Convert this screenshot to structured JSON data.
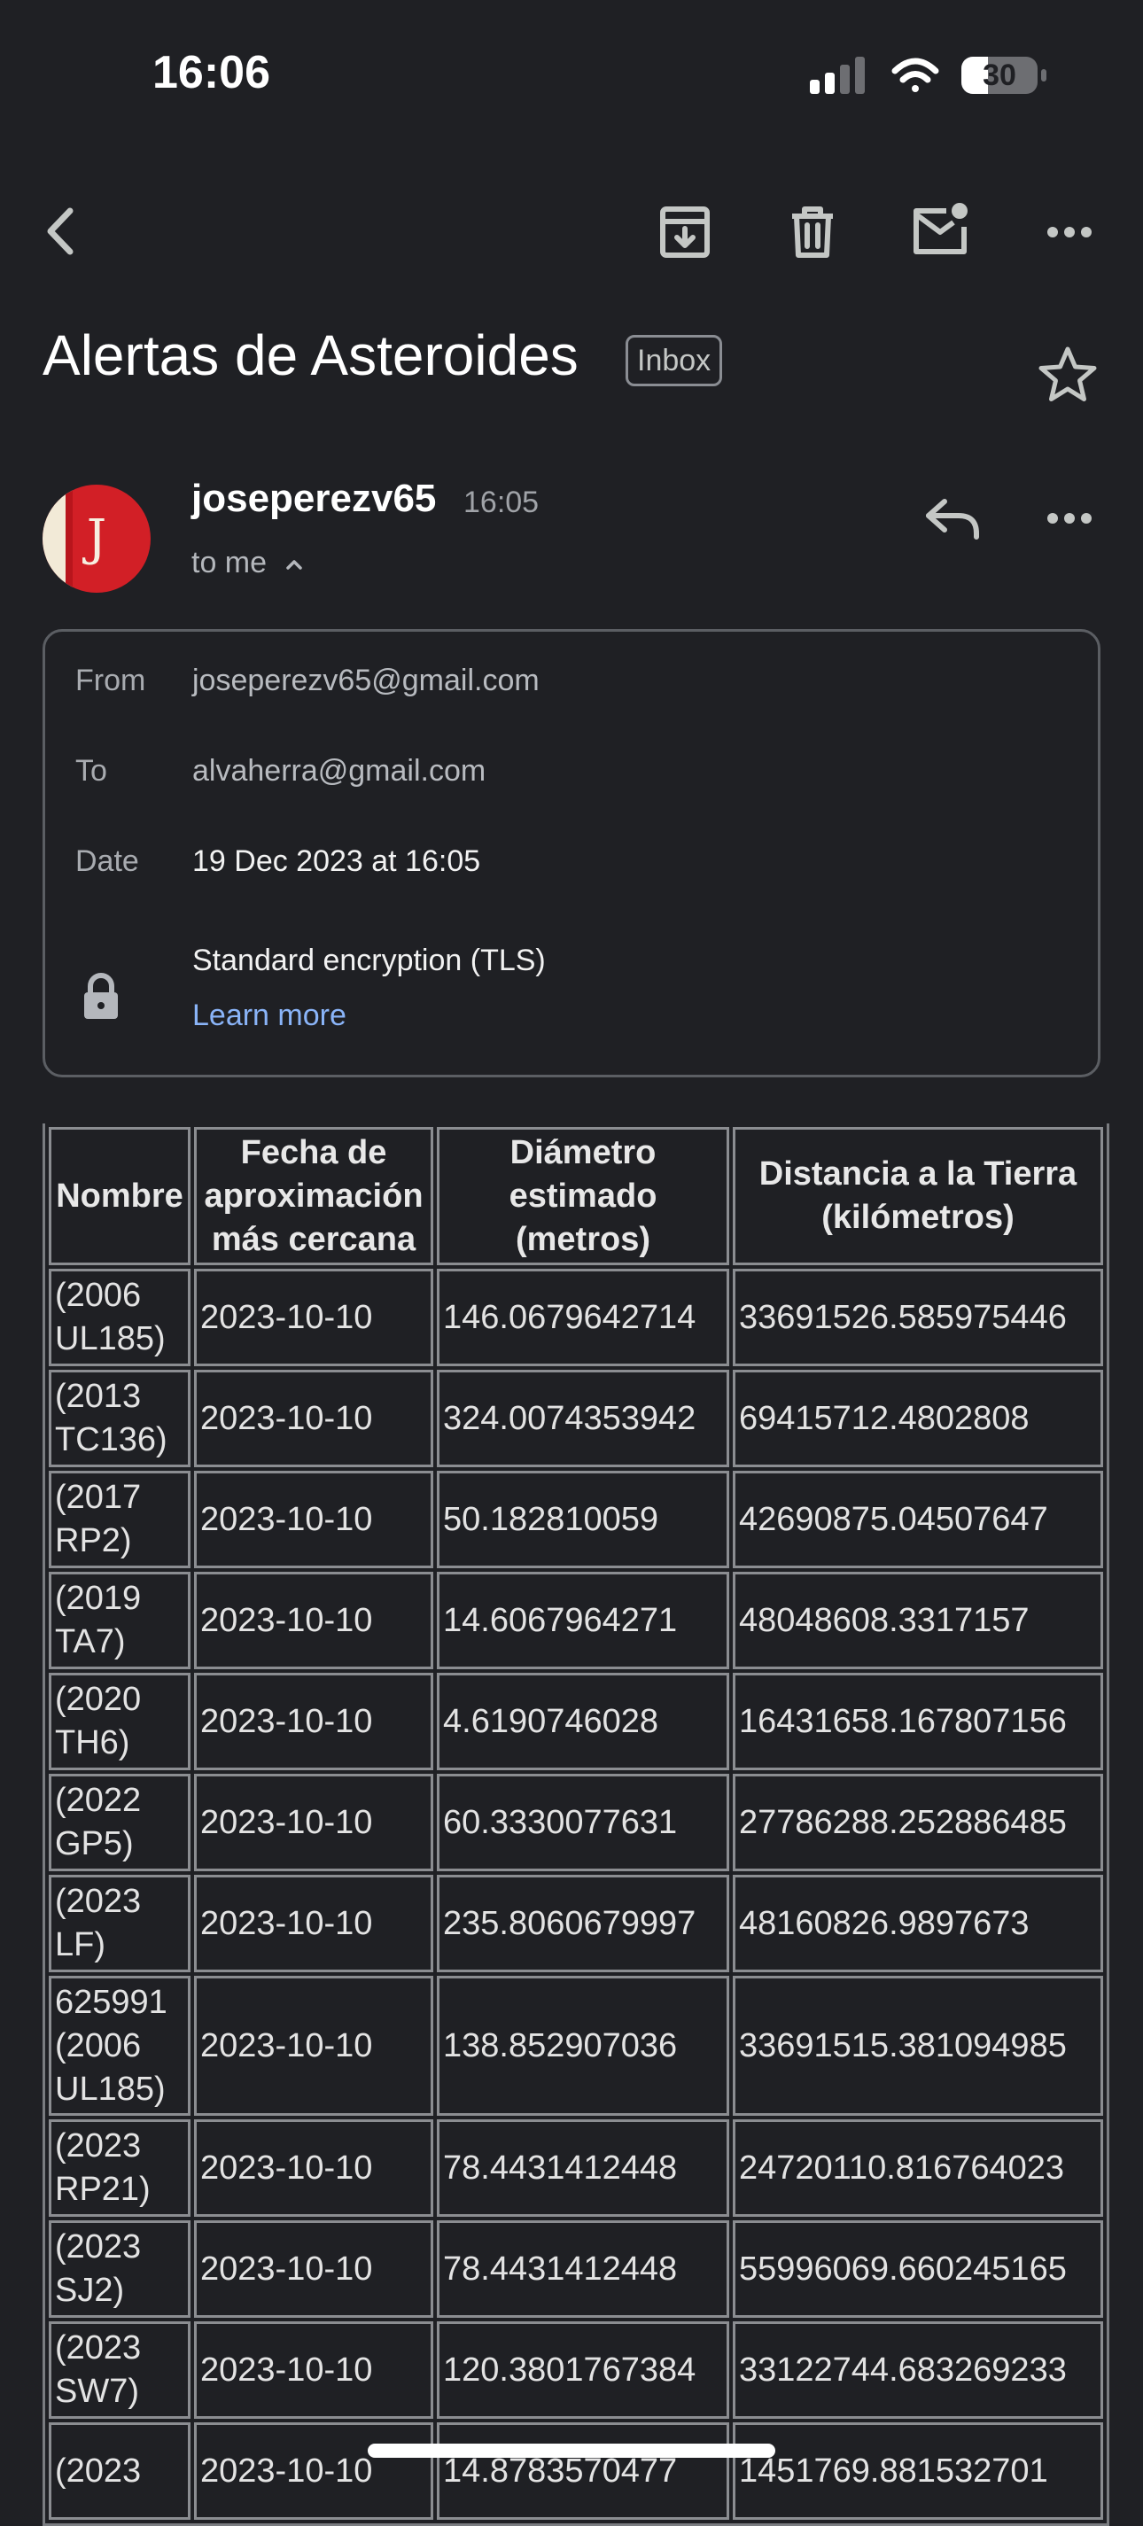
{
  "status_bar": {
    "time": "16:06",
    "battery": "30"
  },
  "header": {
    "subject": "Alertas de Asteroides",
    "label_badge": "Inbox"
  },
  "message": {
    "sender": "joseperezv65",
    "time": "16:05",
    "recipient_summary": "to me",
    "avatar_letter": "J"
  },
  "details": {
    "from_label": "From",
    "from_value": "joseperezv65@gmail.com",
    "to_label": "To",
    "to_value": "alvaherra@gmail.com",
    "date_label": "Date",
    "date_value": "19 Dec 2023 at 16:05",
    "encryption": "Standard encryption (TLS)",
    "learn_more": "Learn more"
  },
  "table": {
    "headers": [
      "Nombre",
      "Fecha de aproximación más cercana",
      "Diámetro estimado (metros)",
      "Distancia a la Tierra (kilómetros)"
    ],
    "rows": [
      [
        "(2006 UL185)",
        "2023-10-10",
        "146.0679642714",
        "33691526.585975446"
      ],
      [
        "(2013 TC136)",
        "2023-10-10",
        "324.0074353942",
        "69415712.4802808"
      ],
      [
        "(2017 RP2)",
        "2023-10-10",
        "50.182810059",
        "42690875.04507647"
      ],
      [
        "(2019 TA7)",
        "2023-10-10",
        "14.6067964271",
        "48048608.3317157"
      ],
      [
        "(2020 TH6)",
        "2023-10-10",
        "4.6190746028",
        "16431658.167807156"
      ],
      [
        "(2022 GP5)",
        "2023-10-10",
        "60.3330077631",
        "27786288.252886485"
      ],
      [
        "(2023 LF)",
        "2023-10-10",
        "235.8060679997",
        "48160826.9897673"
      ],
      [
        "625991 (2006 UL185)",
        "2023-10-10",
        "138.852907036",
        "33691515.381094985"
      ],
      [
        "(2023 RP21)",
        "2023-10-10",
        "78.4431412448",
        "24720110.816764023"
      ],
      [
        "(2023 SJ2)",
        "2023-10-10",
        "78.4431412448",
        "55996069.660245165"
      ],
      [
        "(2023 SW7)",
        "2023-10-10",
        "120.3801767384",
        "33122744.683269233"
      ],
      [
        "(2023",
        "2023-10-10",
        "14.8783570477",
        "1451769.881532701"
      ]
    ]
  },
  "icons": {
    "back": "chevron-left-icon",
    "archive": "archive-icon",
    "delete": "trash-icon",
    "mark_unread": "mail-unread-icon",
    "more": "more-horizontal-icon",
    "star": "star-icon",
    "reply": "reply-icon",
    "lock": "lock-icon"
  }
}
